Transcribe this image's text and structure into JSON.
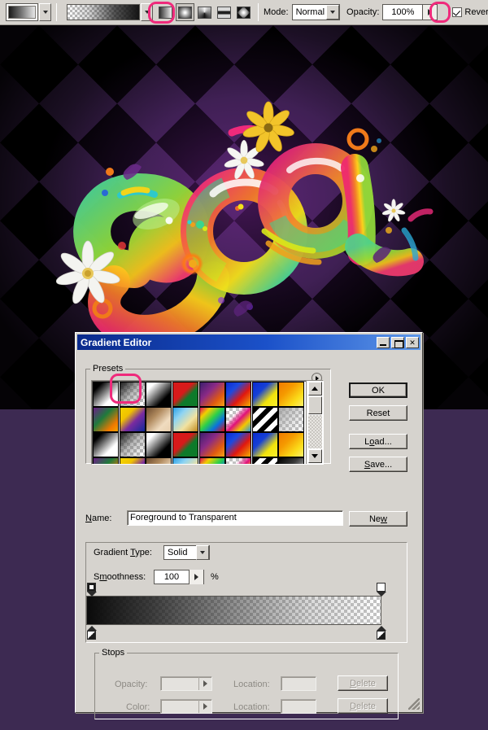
{
  "options_bar": {
    "gradient_swatch_name": "Foreground to Transparent",
    "gradient_type_buttons": [
      {
        "name": "linear-gradient",
        "label": "Linear Gradient",
        "selected": false
      },
      {
        "name": "radial-gradient",
        "label": "Radial Gradient",
        "selected": true
      },
      {
        "name": "angle-gradient",
        "label": "Angle Gradient",
        "selected": false
      },
      {
        "name": "reflected-gradient",
        "label": "Reflected Gradient",
        "selected": false
      },
      {
        "name": "diamond-gradient",
        "label": "Diamond Gradient",
        "selected": false
      }
    ],
    "mode_label": "Mode:",
    "mode_value": "Normal",
    "opacity_label": "Opacity:",
    "opacity_value": "100%",
    "reverse_label": "Reverse",
    "reverse_checked": true,
    "dither_checked": true,
    "highlight_color": "#ef2a7b"
  },
  "canvas": {
    "background_dark": "#000000",
    "background_purple": "#3d2350",
    "desktop_color": "#3d2a52",
    "artwork_text": "COOL"
  },
  "dialog": {
    "title": "Gradient Editor",
    "titlebar_buttons": {
      "minimize": "_",
      "maximize": "□",
      "close": "✕"
    },
    "presets": {
      "legend": "Presets",
      "selected_index": 1,
      "swatches": [
        "linear-gradient(135deg,#000000 0%,#000000 18%,#ffffff 70%,#ffffff 100%)",
        "linear-gradient(135deg,#1a1a1a 0%,rgba(120,120,120,0.55) 45%,rgba(255,255,255,0) 92%)",
        "linear-gradient(135deg,#ffffff 0%,#ffffff 18%,#000000 72%,#000000 100%)",
        "linear-gradient(135deg,#d71a1a 0%,#d71a1a 42%,#0d7a2a 62%,#0d7a2a 100%)",
        "linear-gradient(135deg,#3c1f6e 0%,#8a2a86 38%,#e05a10 72%,#f6a315 100%)",
        "linear-gradient(135deg,#0b2bd1 0%,#1c4ae0 30%,#e0170f 62%,#f3b000 100%)",
        "linear-gradient(135deg,#0b2bd1 0%,#1640d6 34%,#f2e30b 68%,#f6ee30 100%)",
        "linear-gradient(135deg,#f07a00 0%,#f59a00 35%,#fbdc1a 72%,#fdf06a 100%)",
        "linear-gradient(135deg,#6b1f86 0%,#1f7a3c 40%,#f07a00 78%,#f6a200 100%)",
        "linear-gradient(135deg,#f4d400 0%,#f0c200 30%,#7a2ba0 58%,#102a9a 100%)",
        "linear-gradient(135deg,#6b4a2e 0%,#b08a5e 35%,#f0dcc0 70%,#e8cfae 100%)",
        "linear-gradient(135deg,#2aa0e8 0%,#8fd4f2 30%,#f2e2a0 64%,#c08a20 100%)",
        "linear-gradient(135deg,#e00a5a 0%,#f2d000 22%,#2ad04a 48%,#0a70e0 72%,#e00a0a 100%)",
        "linear-gradient(135deg,rgba(255,255,255,0) 0%,rgba(255,255,255,0.1) 30%,#e0107a 52%,#f2c800 74%,#2a9ae0 100%)",
        "repeating-linear-gradient(135deg,#000000 0 6px,#ffffff 6px 12px)",
        "linear-gradient(135deg,rgba(160,160,160,0.9) 0%,rgba(170,170,170,0.35) 55%,rgba(255,255,255,0) 100%)",
        "linear-gradient(135deg,#000000 0%,#000000 18%,#ffffff 70%,#ffffff 100%)",
        "linear-gradient(135deg,#1a1a1a 0%,rgba(120,120,120,0.55) 45%,rgba(255,255,255,0) 92%)",
        "linear-gradient(135deg,#ffffff 0%,#ffffff 18%,#000000 72%,#000000 100%)",
        "linear-gradient(135deg,#d71a1a 0%,#d71a1a 42%,#0d7a2a 62%,#0d7a2a 100%)",
        "linear-gradient(135deg,#3c1f6e 0%,#8a2a86 38%,#e05a10 72%,#f6a315 100%)",
        "linear-gradient(135deg,#0b2bd1 0%,#1c4ae0 30%,#e0170f 62%,#f3b000 100%)",
        "linear-gradient(135deg,#0b2bd1 0%,#1640d6 34%,#f2e30b 68%,#f6ee30 100%)",
        "linear-gradient(135deg,#f07a00 0%,#f59a00 35%,#fbdc1a 72%,#fdf06a 100%)",
        "linear-gradient(135deg,#6b1f86 0%,#1f7a3c 40%,#f07a00 78%,#f6a200 100%)",
        "linear-gradient(135deg,#f4d400 0%,#f0c200 30%,#7a2ba0 58%,#102a9a 100%)",
        "linear-gradient(135deg,#6b4a2e 0%,#b08a5e 35%,#f0dcc0 70%,#e8cfae 100%)",
        "linear-gradient(135deg,#2aa0e8 0%,#8fd4f2 30%,#f2e2a0 64%,#c08a20 100%)",
        "linear-gradient(135deg,#e00a5a 0%,#f2d000 22%,#2ad04a 48%,#0a70e0 72%,#e00a0a 100%)",
        "linear-gradient(135deg,rgba(255,255,255,0) 0%,rgba(255,255,255,0.1) 30%,#e0107a 52%,#f2c800 74%,#2a9ae0 100%)",
        "repeating-linear-gradient(135deg,#000000 0 6px,#ffffff 6px 12px)",
        "linear-gradient(135deg,#000000 0%,#3a3a3a 40%,#ffffff 100%)"
      ]
    },
    "buttons": {
      "ok": "OK",
      "reset": "Reset",
      "load": "Load...",
      "save": "Save...",
      "new": "New"
    },
    "name_label": "Name:",
    "name_value": "Foreground to Transparent",
    "gradient_type_label": "Gradient Type:",
    "gradient_type_value": "Solid",
    "smoothness_label": "Smoothness:",
    "smoothness_value": "100",
    "percent_sign": "%",
    "stops": {
      "legend": "Stops",
      "opacity_label": "Opacity:",
      "opacity_value": "",
      "opacity_location_label": "Location:",
      "opacity_location_value": "",
      "color_label": "Color:",
      "color_value": "",
      "color_location_label": "Location:",
      "color_location_value": "",
      "delete_label": "Delete"
    }
  }
}
